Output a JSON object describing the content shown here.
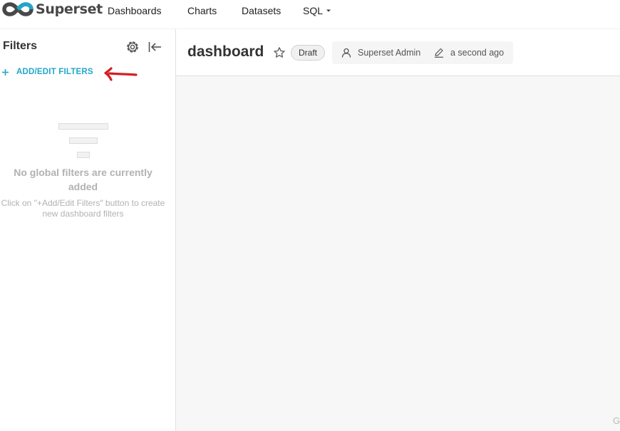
{
  "app": {
    "brand_name": "Superset",
    "accent_color": "#20a7c9"
  },
  "nav": {
    "items": [
      {
        "label": "Dashboards"
      },
      {
        "label": "Charts"
      },
      {
        "label": "Datasets"
      },
      {
        "label": "SQL"
      }
    ]
  },
  "sidebar": {
    "title": "Filters",
    "settings_icon": "gear-icon",
    "collapse_icon": "collapse-left-icon",
    "add_filters_label": "ADD/EDIT FILTERS",
    "empty_title": "No global filters are currently added",
    "empty_description": "Click on \"+Add/Edit Filters\" button to create new dashboard filters"
  },
  "dashboard": {
    "title": "dashboard",
    "status_badge": "Draft",
    "owner": "Superset Admin",
    "last_modified": "a second ago",
    "corner_text": "G"
  }
}
